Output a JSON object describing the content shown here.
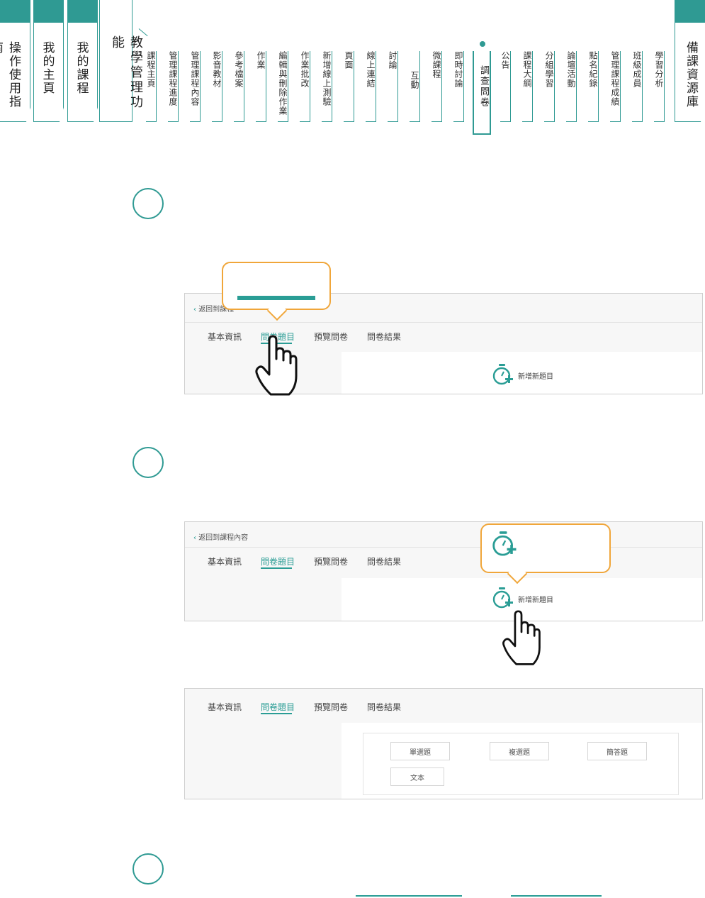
{
  "top_nav": {
    "left_tabs": [
      "操作使用指南",
      "我的主頁",
      "我的課程"
    ],
    "main_tab": "教學管理功能",
    "right_tab": "備課資源庫",
    "sub_items": [
      "課程主頁",
      "管理課程進度",
      "管理課程內容",
      "影音教材",
      "參考檔案",
      "作業",
      "編輯與刪除作業",
      "作業批改",
      "新增線上測驗",
      "頁面",
      "線上連結",
      "討論",
      "互動",
      "微課程",
      "即時討論",
      "調查問卷",
      "公告",
      "課程大綱",
      "分組學習",
      "論壇活動",
      "點名紀錄",
      "管理課程成績",
      "班級成員",
      "學習分析"
    ],
    "active_item": "調查問卷"
  },
  "colors": {
    "accent": "#2f9a93",
    "callout": "#f0a63a"
  },
  "panel1": {
    "back_link": "返回到課程",
    "tabs": [
      "基本資訊",
      "問卷題目",
      "預覽問卷",
      "問卷結果"
    ],
    "active_tab": "問卷題目",
    "add_label": "新增新題目"
  },
  "panel2": {
    "back_link": "返回到課程內容",
    "tabs": [
      "基本資訊",
      "問卷題目",
      "預覽問卷",
      "問卷結果"
    ],
    "active_tab": "問卷題目",
    "add_label": "新增新題目"
  },
  "panel3": {
    "tabs": [
      "基本資訊",
      "問卷題目",
      "預覽問卷",
      "問卷結果"
    ],
    "active_tab": "問卷題目",
    "question_types": [
      "單選題",
      "複選題",
      "簡答題",
      "文本"
    ]
  },
  "icons": [
    "stopwatch-plus-icon",
    "hand-pointer-icon",
    "chevron-left-icon"
  ]
}
